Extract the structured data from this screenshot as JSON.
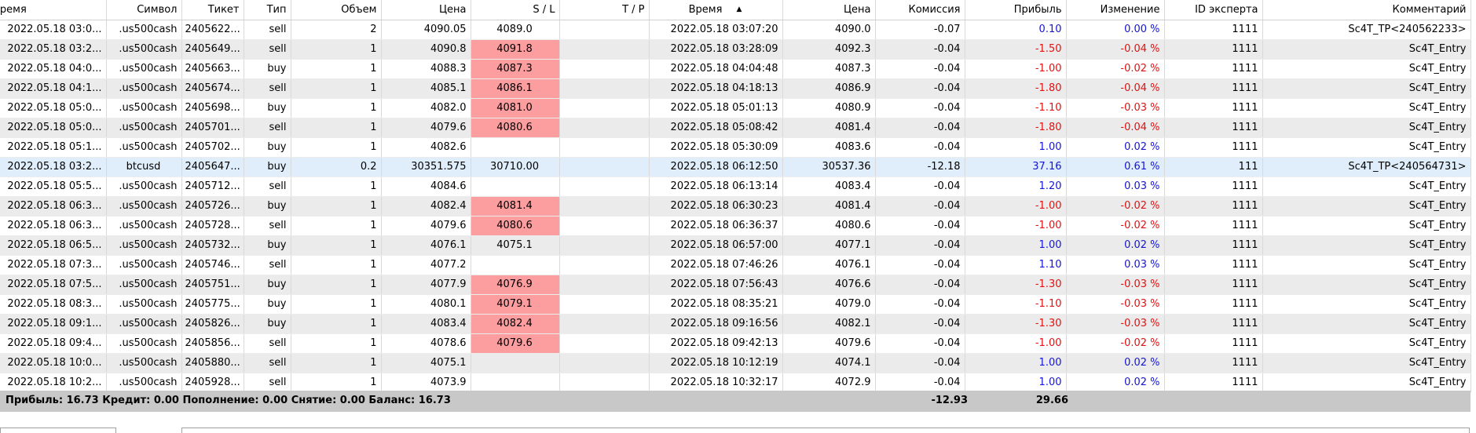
{
  "columns": [
    {
      "key": "time",
      "label": "Время"
    },
    {
      "key": "symbol",
      "label": "Символ"
    },
    {
      "key": "ticket",
      "label": "Тикет"
    },
    {
      "key": "type",
      "label": "Тип"
    },
    {
      "key": "volume",
      "label": "Объем"
    },
    {
      "key": "price",
      "label": "Цена"
    },
    {
      "key": "sl",
      "label": "S / L"
    },
    {
      "key": "tp",
      "label": "T / P"
    },
    {
      "key": "close_time",
      "label": "Время"
    },
    {
      "key": "close_price",
      "label": "Цена"
    },
    {
      "key": "commission",
      "label": "Комиссия"
    },
    {
      "key": "profit",
      "label": "Прибыль"
    },
    {
      "key": "change",
      "label": "Изменение"
    },
    {
      "key": "expert_id",
      "label": "ID эксперта"
    },
    {
      "key": "comment",
      "label": "Комментарий"
    }
  ],
  "sort_column": "close_time",
  "colors": {
    "stop_loss_hit": "#fc9ea0",
    "positive": "#1515d8",
    "negative": "#e31111",
    "highlight_row": "#dfeefa",
    "summary_bg": "#c8c8c8"
  },
  "rows": [
    {
      "time": "2022.05.18 03:0...",
      "symbol": ".us500cash",
      "ticket": "2405622...",
      "type": "sell",
      "volume": "2",
      "price": "4090.05",
      "sl": "4089.0",
      "sl_hit": false,
      "tp": "",
      "close_time": "2022.05.18 03:07:20",
      "close_price": "4090.0",
      "commission": "-0.07",
      "profit": "0.10",
      "change": "0.00 %",
      "expert_id": "1111",
      "comment": "Sc4T_TP<240562233>"
    },
    {
      "time": "2022.05.18 03:2...",
      "symbol": ".us500cash",
      "ticket": "2405649...",
      "type": "sell",
      "volume": "1",
      "price": "4090.8",
      "sl": "4091.8",
      "sl_hit": true,
      "tp": "",
      "close_time": "2022.05.18 03:28:09",
      "close_price": "4092.3",
      "commission": "-0.04",
      "profit": "-1.50",
      "change": "-0.04 %",
      "expert_id": "1111",
      "comment": "Sc4T_Entry"
    },
    {
      "time": "2022.05.18 04:0...",
      "symbol": ".us500cash",
      "ticket": "2405663...",
      "type": "buy",
      "volume": "1",
      "price": "4088.3",
      "sl": "4087.3",
      "sl_hit": true,
      "tp": "",
      "close_time": "2022.05.18 04:04:48",
      "close_price": "4087.3",
      "commission": "-0.04",
      "profit": "-1.00",
      "change": "-0.02 %",
      "expert_id": "1111",
      "comment": "Sc4T_Entry"
    },
    {
      "time": "2022.05.18 04:1...",
      "symbol": ".us500cash",
      "ticket": "2405674...",
      "type": "sell",
      "volume": "1",
      "price": "4085.1",
      "sl": "4086.1",
      "sl_hit": true,
      "tp": "",
      "close_time": "2022.05.18 04:18:13",
      "close_price": "4086.9",
      "commission": "-0.04",
      "profit": "-1.80",
      "change": "-0.04 %",
      "expert_id": "1111",
      "comment": "Sc4T_Entry"
    },
    {
      "time": "2022.05.18 05:0...",
      "symbol": ".us500cash",
      "ticket": "2405698...",
      "type": "buy",
      "volume": "1",
      "price": "4082.0",
      "sl": "4081.0",
      "sl_hit": true,
      "tp": "",
      "close_time": "2022.05.18 05:01:13",
      "close_price": "4080.9",
      "commission": "-0.04",
      "profit": "-1.10",
      "change": "-0.03 %",
      "expert_id": "1111",
      "comment": "Sc4T_Entry"
    },
    {
      "time": "2022.05.18 05:0...",
      "symbol": ".us500cash",
      "ticket": "2405701...",
      "type": "sell",
      "volume": "1",
      "price": "4079.6",
      "sl": "4080.6",
      "sl_hit": true,
      "tp": "",
      "close_time": "2022.05.18 05:08:42",
      "close_price": "4081.4",
      "commission": "-0.04",
      "profit": "-1.80",
      "change": "-0.04 %",
      "expert_id": "1111",
      "comment": "Sc4T_Entry"
    },
    {
      "time": "2022.05.18 05:1...",
      "symbol": ".us500cash",
      "ticket": "2405702...",
      "type": "buy",
      "volume": "1",
      "price": "4082.6",
      "sl": "",
      "sl_hit": false,
      "tp": "",
      "close_time": "2022.05.18 05:30:09",
      "close_price": "4083.6",
      "commission": "-0.04",
      "profit": "1.00",
      "change": "0.02 %",
      "expert_id": "1111",
      "comment": "Sc4T_Entry"
    },
    {
      "time": "2022.05.18 03:2...",
      "symbol": "btcusd",
      "ticket": "2405647...",
      "type": "buy",
      "volume": "0.2",
      "price": "30351.575",
      "sl": "30710.00",
      "sl_hit": false,
      "tp": "",
      "close_time": "2022.05.18 06:12:50",
      "close_price": "30537.36",
      "commission": "-12.18",
      "profit": "37.16",
      "change": "0.61 %",
      "expert_id": "111",
      "comment": "Sc4T_TP<240564731>",
      "highlight": true
    },
    {
      "time": "2022.05.18 05:5...",
      "symbol": ".us500cash",
      "ticket": "2405712...",
      "type": "sell",
      "volume": "1",
      "price": "4084.6",
      "sl": "",
      "sl_hit": false,
      "tp": "",
      "close_time": "2022.05.18 06:13:14",
      "close_price": "4083.4",
      "commission": "-0.04",
      "profit": "1.20",
      "change": "0.03 %",
      "expert_id": "1111",
      "comment": "Sc4T_Entry"
    },
    {
      "time": "2022.05.18 06:3...",
      "symbol": ".us500cash",
      "ticket": "2405726...",
      "type": "buy",
      "volume": "1",
      "price": "4082.4",
      "sl": "4081.4",
      "sl_hit": true,
      "tp": "",
      "close_time": "2022.05.18 06:30:23",
      "close_price": "4081.4",
      "commission": "-0.04",
      "profit": "-1.00",
      "change": "-0.02 %",
      "expert_id": "1111",
      "comment": "Sc4T_Entry"
    },
    {
      "time": "2022.05.18 06:3...",
      "symbol": ".us500cash",
      "ticket": "2405728...",
      "type": "sell",
      "volume": "1",
      "price": "4079.6",
      "sl": "4080.6",
      "sl_hit": true,
      "tp": "",
      "close_time": "2022.05.18 06:36:37",
      "close_price": "4080.6",
      "commission": "-0.04",
      "profit": "-1.00",
      "change": "-0.02 %",
      "expert_id": "1111",
      "comment": "Sc4T_Entry"
    },
    {
      "time": "2022.05.18 06:5...",
      "symbol": ".us500cash",
      "ticket": "2405732...",
      "type": "buy",
      "volume": "1",
      "price": "4076.1",
      "sl": "4075.1",
      "sl_hit": false,
      "tp": "",
      "close_time": "2022.05.18 06:57:00",
      "close_price": "4077.1",
      "commission": "-0.04",
      "profit": "1.00",
      "change": "0.02 %",
      "expert_id": "1111",
      "comment": "Sc4T_Entry"
    },
    {
      "time": "2022.05.18 07:3...",
      "symbol": ".us500cash",
      "ticket": "2405746...",
      "type": "sell",
      "volume": "1",
      "price": "4077.2",
      "sl": "",
      "sl_hit": false,
      "tp": "",
      "close_time": "2022.05.18 07:46:26",
      "close_price": "4076.1",
      "commission": "-0.04",
      "profit": "1.10",
      "change": "0.03 %",
      "expert_id": "1111",
      "comment": "Sc4T_Entry"
    },
    {
      "time": "2022.05.18 07:5...",
      "symbol": ".us500cash",
      "ticket": "2405751...",
      "type": "buy",
      "volume": "1",
      "price": "4077.9",
      "sl": "4076.9",
      "sl_hit": true,
      "tp": "",
      "close_time": "2022.05.18 07:56:43",
      "close_price": "4076.6",
      "commission": "-0.04",
      "profit": "-1.30",
      "change": "-0.03 %",
      "expert_id": "1111",
      "comment": "Sc4T_Entry"
    },
    {
      "time": "2022.05.18 08:3...",
      "symbol": ".us500cash",
      "ticket": "2405775...",
      "type": "buy",
      "volume": "1",
      "price": "4080.1",
      "sl": "4079.1",
      "sl_hit": true,
      "tp": "",
      "close_time": "2022.05.18 08:35:21",
      "close_price": "4079.0",
      "commission": "-0.04",
      "profit": "-1.10",
      "change": "-0.03 %",
      "expert_id": "1111",
      "comment": "Sc4T_Entry"
    },
    {
      "time": "2022.05.18 09:1...",
      "symbol": ".us500cash",
      "ticket": "2405826...",
      "type": "buy",
      "volume": "1",
      "price": "4083.4",
      "sl": "4082.4",
      "sl_hit": true,
      "tp": "",
      "close_time": "2022.05.18 09:16:56",
      "close_price": "4082.1",
      "commission": "-0.04",
      "profit": "-1.30",
      "change": "-0.03 %",
      "expert_id": "1111",
      "comment": "Sc4T_Entry"
    },
    {
      "time": "2022.05.18 09:4...",
      "symbol": ".us500cash",
      "ticket": "2405856...",
      "type": "sell",
      "volume": "1",
      "price": "4078.6",
      "sl": "4079.6",
      "sl_hit": true,
      "tp": "",
      "close_time": "2022.05.18 09:42:13",
      "close_price": "4079.6",
      "commission": "-0.04",
      "profit": "-1.00",
      "change": "-0.02 %",
      "expert_id": "1111",
      "comment": "Sc4T_Entry"
    },
    {
      "time": "2022.05.18 10:0...",
      "symbol": ".us500cash",
      "ticket": "2405880...",
      "type": "sell",
      "volume": "1",
      "price": "4075.1",
      "sl": "",
      "sl_hit": false,
      "tp": "",
      "close_time": "2022.05.18 10:12:19",
      "close_price": "4074.1",
      "commission": "-0.04",
      "profit": "1.00",
      "change": "0.02 %",
      "expert_id": "1111",
      "comment": "Sc4T_Entry"
    },
    {
      "time": "2022.05.18 10:2...",
      "symbol": ".us500cash",
      "ticket": "2405928...",
      "type": "sell",
      "volume": "1",
      "price": "4073.9",
      "sl": "",
      "sl_hit": false,
      "tp": "",
      "close_time": "2022.05.18 10:32:17",
      "close_price": "4072.9",
      "commission": "-0.04",
      "profit": "1.00",
      "change": "0.02 %",
      "expert_id": "1111",
      "comment": "Sc4T_Entry"
    }
  ],
  "summary": {
    "text": "Прибыль: 16.73  Кредит: 0.00  Пополнение: 0.00  Снятие: 0.00  Баланс: 16.73",
    "commission_total": "-12.93",
    "profit_total": "29.66"
  }
}
